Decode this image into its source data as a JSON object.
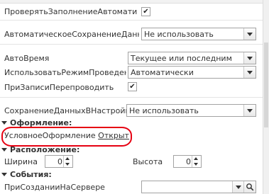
{
  "props": {
    "check_fill": {
      "label": "ПроверятьЗаполнениеАвтоматическ",
      "checked": true
    },
    "auto_save": {
      "label": "АвтоматическоеСохранениеДанныхВ",
      "value": "Не использовать"
    },
    "autotime": {
      "label": "АвтоВремя",
      "value": "Текущее или последним"
    },
    "posting_mode": {
      "label": "ИспользоватьРежимПроведения",
      "value": "Автоматически"
    },
    "repost_on_write": {
      "label": "ПриЗаписиПерепроводить",
      "checked": true
    },
    "save_settings": {
      "label": "СохранениеДанныхВНастройках",
      "value": "Не использовать"
    }
  },
  "sections": {
    "design": {
      "title": "Оформление:",
      "conditional_label": "УсловноеОформление",
      "conditional_link": "Открыть"
    },
    "layout": {
      "title": "Расположение:",
      "width_label": "Ширина",
      "width_value": "0",
      "height_label": "Высота",
      "height_value": "0"
    },
    "events": {
      "title": "События:",
      "on_create_label": "ПриСозданииНаСервере"
    }
  },
  "colors": {
    "highlight": "#e60012"
  },
  "icons": {
    "check": "✔",
    "magnifier": "search-icon"
  }
}
